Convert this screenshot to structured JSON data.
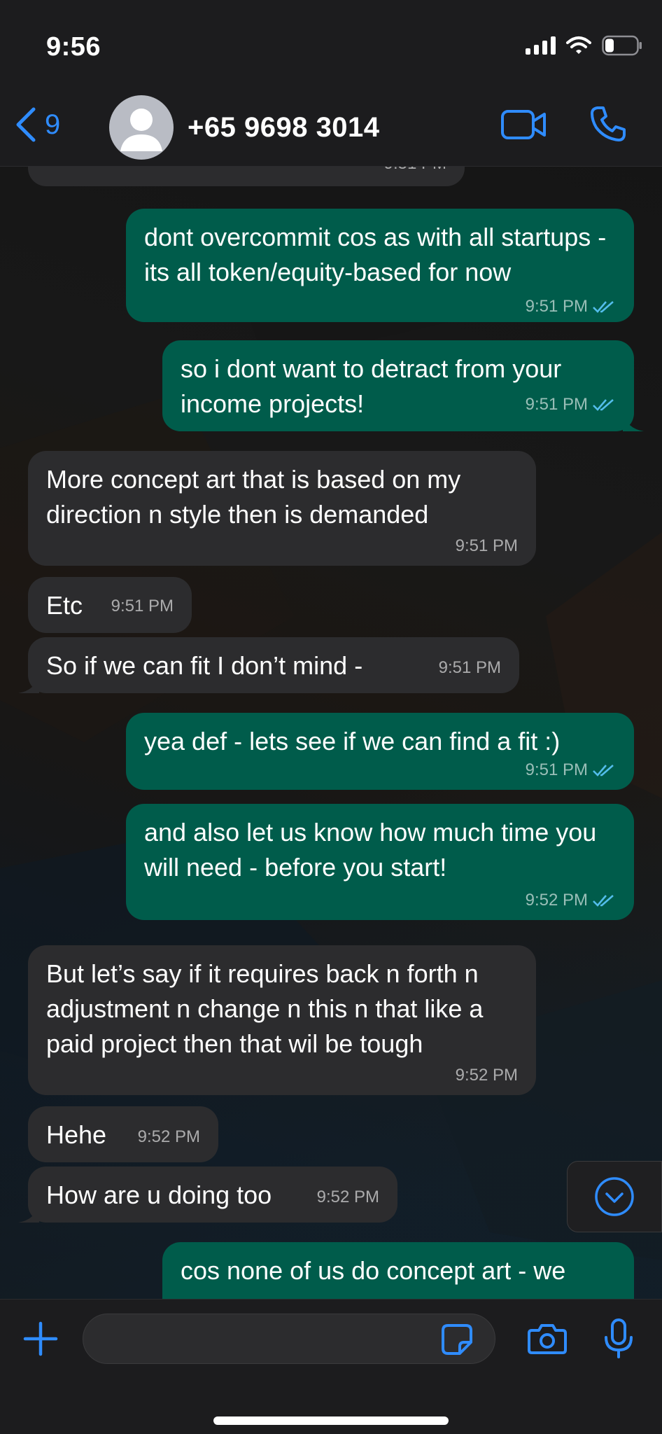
{
  "status_bar": {
    "time": "9:56"
  },
  "header": {
    "back_count": "9",
    "contact_name": "+65 9698 3014"
  },
  "colors": {
    "accent": "#2f8cff",
    "outgoing_bubble": "#005c4b",
    "incoming_bubble": "#2c2c2e",
    "read_ticks": "#53bdeb"
  },
  "messages": [
    {
      "dir": "in",
      "text": "",
      "time": "9:51 PM"
    },
    {
      "dir": "out",
      "text": "dont overcommit cos as with all startups - its all token/equity-based for now",
      "time": "9:51 PM",
      "read": true
    },
    {
      "dir": "out",
      "text": "so i dont want to detract from your income projects!",
      "time": "9:51 PM",
      "read": true
    },
    {
      "dir": "in",
      "text": "More concept art that is based on my direction n style then is demanded",
      "time": "9:51 PM"
    },
    {
      "dir": "in",
      "text": "Etc",
      "time": "9:51 PM"
    },
    {
      "dir": "in",
      "text": "So if we can fit I don’t mind -",
      "time": "9:51 PM"
    },
    {
      "dir": "out",
      "text": "yea def - lets see if we can find a fit :)",
      "time": "9:51 PM",
      "read": true
    },
    {
      "dir": "out",
      "text": "and also let us know how much time you will need - before you start!",
      "time": "9:52 PM",
      "read": true
    },
    {
      "dir": "in",
      "text": "But let’s say if it requires back n forth n adjustment n change n this n that like a paid project then that wil be tough",
      "time": "9:52 PM"
    },
    {
      "dir": "in",
      "text": "Hehe",
      "time": "9:52 PM"
    },
    {
      "dir": "in",
      "text": "How are u doing too",
      "time": "9:52 PM"
    },
    {
      "dir": "out",
      "text": "cos none of us do concept art - we",
      "time": "",
      "read": false
    }
  ],
  "composer": {
    "placeholder": ""
  },
  "icons": {
    "back": "chevron-left-icon",
    "avatar": "person-icon",
    "video": "video-camera-icon",
    "call": "phone-icon",
    "scroll": "chevron-down-circle-icon",
    "attach": "plus-icon",
    "sticker": "sticker-icon",
    "camera": "camera-icon",
    "mic": "microphone-icon"
  }
}
